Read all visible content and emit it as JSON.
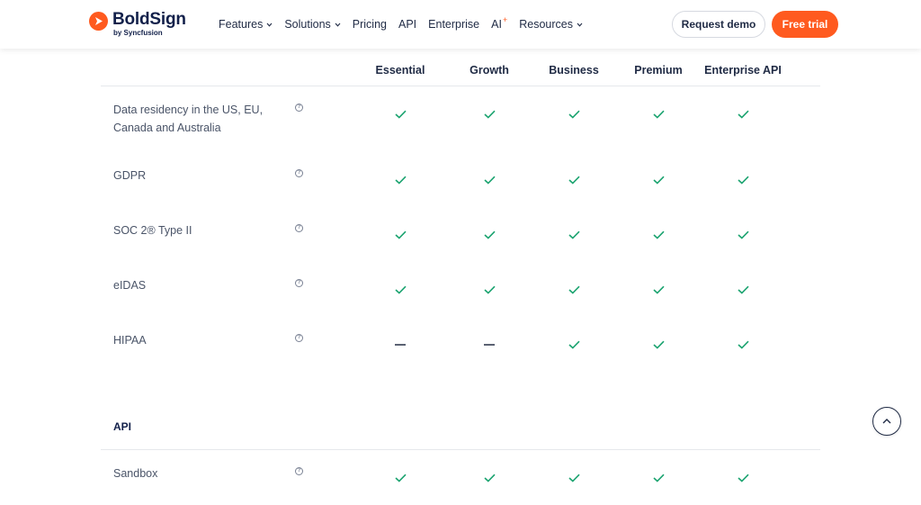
{
  "header": {
    "logo_name": "BoldSign",
    "logo_sub": "by Syncfusion",
    "nav": [
      {
        "label": "Features",
        "dropdown": true
      },
      {
        "label": "Solutions",
        "dropdown": true
      },
      {
        "label": "Pricing",
        "dropdown": false
      },
      {
        "label": "API",
        "dropdown": false
      },
      {
        "label": "Enterprise",
        "dropdown": false
      },
      {
        "label": "AI",
        "dropdown": false
      },
      {
        "label": "Resources",
        "dropdown": true
      }
    ],
    "ai_spark": "+",
    "request_demo": "Request demo",
    "free_trial": "Free trial"
  },
  "colors": {
    "accent": "#ff5a1f",
    "check": "#1aa36f",
    "text": "#1f2a44"
  },
  "table": {
    "plans": [
      "Essential",
      "Growth",
      "Business",
      "Premium",
      "Enterprise API"
    ],
    "rows": [
      {
        "feature": "Data residency in the US, EU, Canada and Australia",
        "values": [
          "check",
          "check",
          "check",
          "check",
          "check"
        ]
      },
      {
        "feature": "GDPR",
        "values": [
          "check",
          "check",
          "check",
          "check",
          "check"
        ]
      },
      {
        "feature": "SOC 2® Type II",
        "values": [
          "check",
          "check",
          "check",
          "check",
          "check"
        ]
      },
      {
        "feature": "eIDAS",
        "values": [
          "check",
          "check",
          "check",
          "check",
          "check"
        ]
      },
      {
        "feature": "HIPAA",
        "values": [
          "dash",
          "dash",
          "check",
          "check",
          "check"
        ]
      }
    ],
    "section_api": {
      "title": "API",
      "rows": [
        {
          "feature": "Sandbox",
          "values": [
            "check",
            "check",
            "check",
            "check",
            "check"
          ]
        }
      ]
    }
  },
  "icons": {
    "info": "info-circle-icon",
    "check": "check-icon",
    "dash": "dash-icon",
    "scroll_top": "chevron-up-icon"
  }
}
